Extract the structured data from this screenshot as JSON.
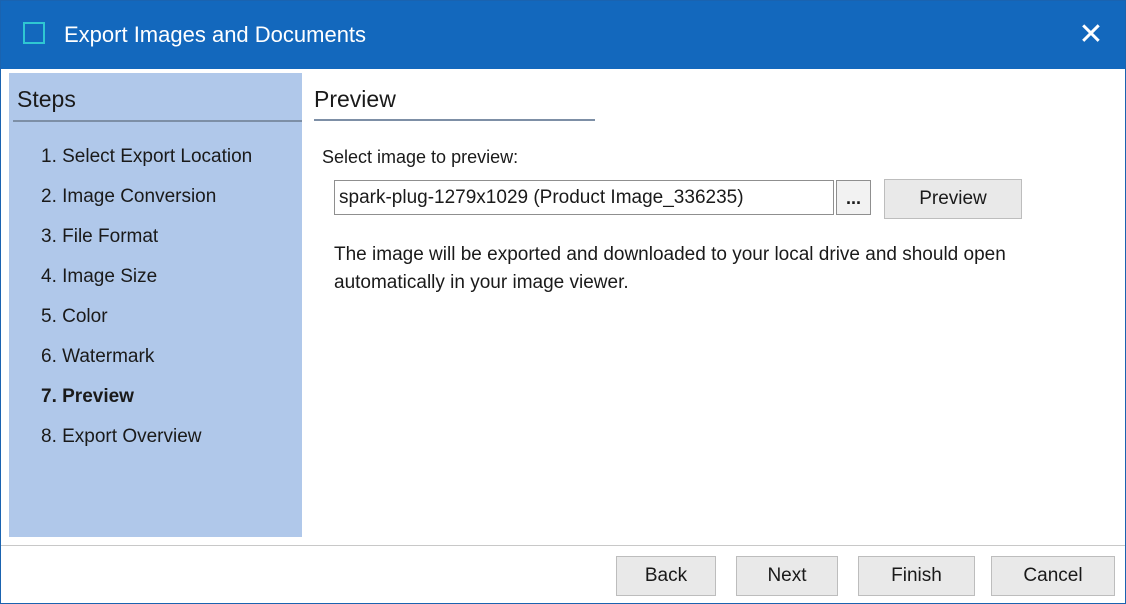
{
  "window": {
    "title": "Export Images and Documents",
    "close_glyph": "✕",
    "accent_color": "#1368bd",
    "icons": [
      "app-icon",
      "close-icon"
    ]
  },
  "sidebar": {
    "title": "Steps",
    "background_color": "#b0c8ea",
    "items": [
      {
        "label": "1. Select Export Location",
        "active": false
      },
      {
        "label": "2. Image Conversion",
        "active": false
      },
      {
        "label": "3. File Format",
        "active": false
      },
      {
        "label": "4. Image Size",
        "active": false
      },
      {
        "label": "5. Color",
        "active": false
      },
      {
        "label": "6. Watermark",
        "active": false
      },
      {
        "label": "7. Preview",
        "active": true
      },
      {
        "label": "8. Export Overview",
        "active": false
      }
    ]
  },
  "main": {
    "section_title": "Preview",
    "field_label": "Select image to preview:",
    "image_input": {
      "value": "spark-plug-1279x1029 (Product Image_336235)"
    },
    "browse_button_label": "...",
    "preview_button_label": "Preview",
    "info_text": "The image will be exported and downloaded to your local drive and should open automatically in your image viewer."
  },
  "footer": {
    "back_label": "Back",
    "next_label": "Next",
    "finish_label": "Finish",
    "cancel_label": "Cancel"
  }
}
